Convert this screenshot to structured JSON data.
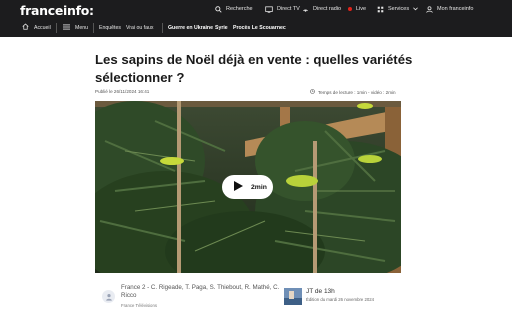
{
  "header": {
    "logo_text": "franceinfo:",
    "search_label": "Recherche",
    "direct_tv_label": "Direct TV",
    "direct_radio_label": "Direct radio",
    "live_label": "Live",
    "services_label": "Services",
    "account_label": "Mon franceinfo"
  },
  "subnav": {
    "home_label": "Accueil",
    "menu_label": "Menu",
    "links": [
      "Enquêtes",
      "Vrai ou faux",
      "Guerre en Ukraine",
      "Syrie",
      "Procès Le Scouarnec"
    ]
  },
  "article": {
    "title": "Les sapins de Noël déjà en vente : quelles variétés sélectionner ?",
    "published": "Publié le 26/11/2024 16:41",
    "reading_time": "Temps de lecture : 1min - vidéo : 2min"
  },
  "video": {
    "duration": "2min"
  },
  "credits": {
    "authors": "France 2 - C. Rigeade, T. Paga, S. Thiebout, R. Mathé, C. Ricco",
    "source": "France Télévisions",
    "program": "JT de 13h",
    "edition": "Édition du mardi 26 novembre 2024"
  },
  "colors": {
    "header_bg": "#1c1c1e",
    "live_dot": "#e2231a",
    "play_button_bg": "#ffffff"
  },
  "icons": [
    "search-icon",
    "tv-icon",
    "radio-icon",
    "live-dot-icon",
    "grid-icon",
    "user-icon",
    "home-icon",
    "menu-icon",
    "play-icon",
    "clock-icon",
    "avatar-icon"
  ]
}
